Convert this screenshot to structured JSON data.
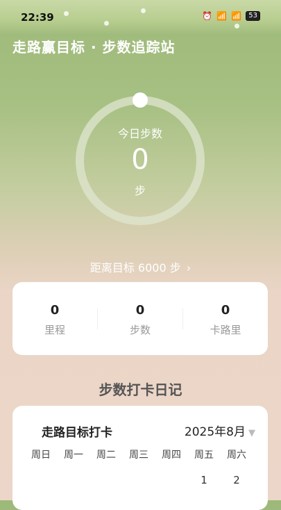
{
  "status": {
    "time": "22:39",
    "battery": "53"
  },
  "header": {
    "title": "走路赢目标 · 步数追踪站"
  },
  "ring": {
    "label": "今日步数",
    "steps": "0",
    "unit": "步",
    "progress": 0
  },
  "goal": {
    "text": "距离目标 6000 步",
    "chevron": "›"
  },
  "stats": [
    {
      "value": "0",
      "label": "里程"
    },
    {
      "value": "0",
      "label": "步数"
    },
    {
      "value": "0",
      "label": "卡路里"
    }
  ],
  "diary": {
    "section_title": "步数打卡日记",
    "card_title": "走路目标打卡",
    "month": "2025年8月",
    "dropdown_icon": "triangle-down-icon",
    "weekdays": [
      "周日",
      "周一",
      "周二",
      "周三",
      "周四",
      "周五",
      "周六"
    ],
    "first_days": [
      "1",
      "2"
    ]
  },
  "colors": {
    "accent": "#9db979",
    "ring_track": "#dfe5d0"
  }
}
